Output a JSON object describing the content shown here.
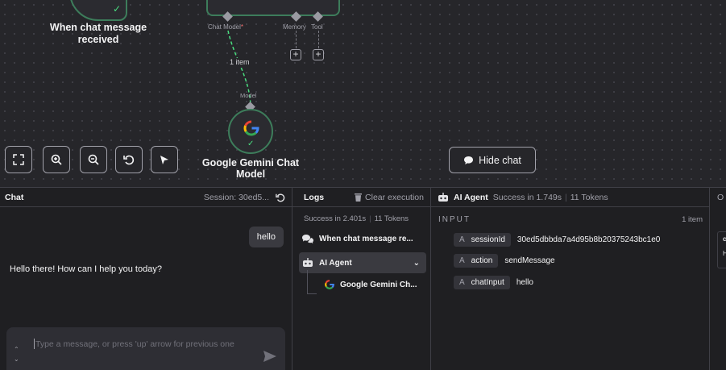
{
  "canvas": {
    "trigger_node": {
      "label": "When chat message received"
    },
    "agent_node": {
      "ports": [
        {
          "label": "Chat Model",
          "required": "*"
        },
        {
          "label": "Memory",
          "required": ""
        },
        {
          "label": "Tool",
          "required": ""
        }
      ]
    },
    "connection_label": "1 item",
    "model_port_label": "Model",
    "gemini_node": {
      "label": "Google Gemini Chat Model"
    },
    "controls": [
      "fit-view",
      "zoom-in",
      "zoom-out",
      "reset",
      "tidy-up"
    ],
    "hide_chat_label": "Hide chat"
  },
  "chat": {
    "title": "Chat",
    "session": "Session: 30ed5...",
    "user_message": "hello",
    "bot_message": "Hello there! How can I help you today?",
    "input_placeholder": "Type a message, or press 'up' arrow for previous one"
  },
  "logs": {
    "title": "Logs",
    "clear_label": "Clear execution",
    "duration": "Success in 2.401s",
    "tokens": "11 Tokens",
    "entries": [
      {
        "label": "When chat message re...",
        "icon": "chat-icon"
      },
      {
        "label": "AI Agent",
        "icon": "robot-icon"
      },
      {
        "label": "Google Gemini Ch...",
        "icon": "google-g-icon"
      }
    ]
  },
  "detail": {
    "node_name": "AI Agent",
    "status": "Success in 1.749s",
    "tokens": "11 Tokens",
    "section_label": "INPUT",
    "item_count": "1 item",
    "fields": [
      {
        "type": "A",
        "key": "sessionId",
        "value": "30ed5dbbda7a4d95b8b20375243bc1e0"
      },
      {
        "type": "A",
        "key": "action",
        "value": "sendMessage"
      },
      {
        "type": "A",
        "key": "chatInput",
        "value": "hello"
      }
    ]
  },
  "output": {
    "label": "O"
  },
  "colors": {
    "success": "#4ade80",
    "node_border": "#3d7d5b",
    "required": "#f87171"
  }
}
